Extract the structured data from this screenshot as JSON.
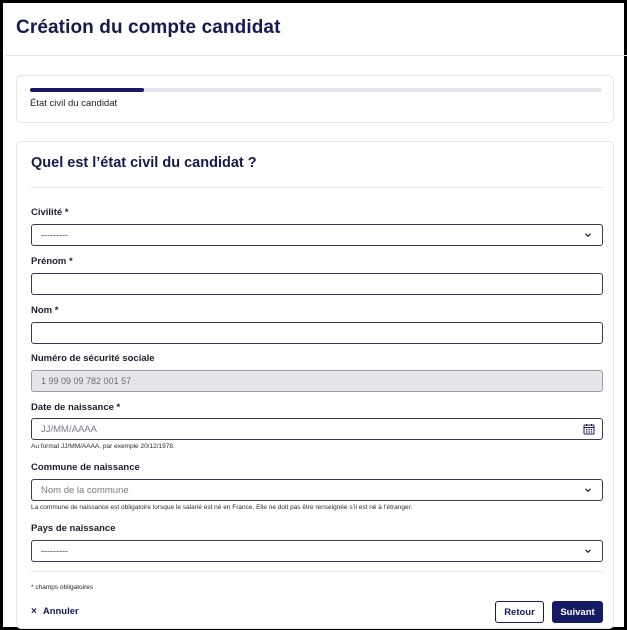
{
  "page": {
    "title": "Création du compte candidat"
  },
  "progress": {
    "step_label": "État civil du candidat",
    "fraction": 0.2
  },
  "form": {
    "title": "Quel est l’état civil du candidat ?",
    "civilite": {
      "label": "Civilité *",
      "value": "---------"
    },
    "prenom": {
      "label": "Prénom *",
      "value": ""
    },
    "nom": {
      "label": "Nom *",
      "value": ""
    },
    "nir": {
      "label": "Numéro de sécurité sociale",
      "value": "1 99 09 09 782 001 57"
    },
    "date_naissance": {
      "label": "Date de naissance *",
      "placeholder": "JJ/MM/AAAA",
      "hint": "Au format JJ/MM/AAAA, par exemple 20/12/1978."
    },
    "commune": {
      "label": "Commune de naissance",
      "placeholder": "Nom de la commune",
      "hint": "La commune de naissance est obligatoire lorsque le salarié est né en France. Elle ne doit pas être renseignée s’il est né à l’étranger."
    },
    "pays": {
      "label": "Pays de naissance",
      "value": "---------"
    },
    "required_note": "* champs obligatoires"
  },
  "actions": {
    "cancel_label": "Annuler",
    "back_label": "Retour",
    "next_label": "Suivant"
  },
  "colors": {
    "primary": "#161a63",
    "title": "#161a4f",
    "disabled_bg": "#e6e6ea"
  },
  "icons": {
    "select": "chevron-down-icon",
    "date": "calendar-icon",
    "cancel": "close-icon"
  }
}
